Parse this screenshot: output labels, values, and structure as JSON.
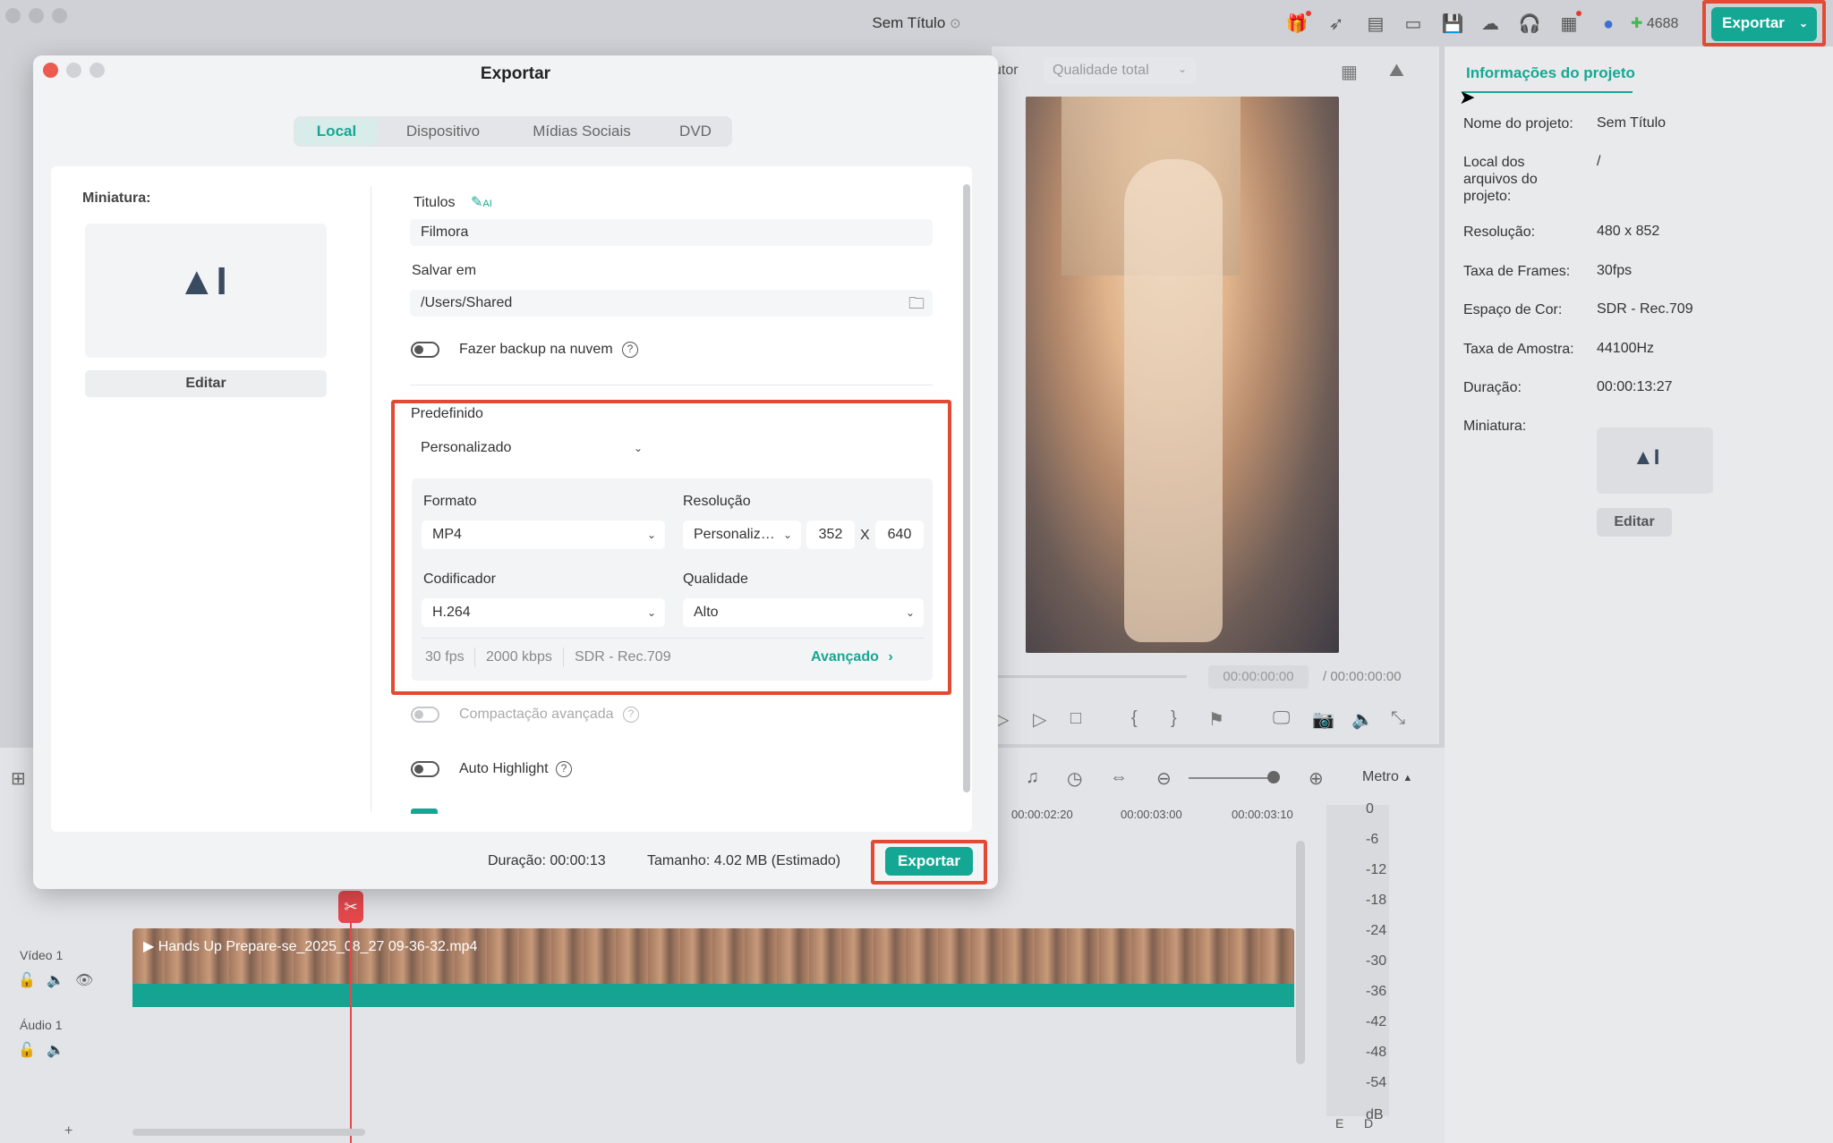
{
  "app": {
    "title": "Sem Título",
    "credits": "4688",
    "export_label": "Exportar"
  },
  "project_info": {
    "tab_label": "Informações do projeto",
    "rows": [
      {
        "label": "Nome do projeto:",
        "value": "Sem Título"
      },
      {
        "label": "Local dos arquivos do projeto:",
        "value": "/"
      },
      {
        "label": "Resolução:",
        "value": "480 x 852"
      },
      {
        "label": "Taxa de Frames:",
        "value": "30fps"
      },
      {
        "label": "Espaço de Cor:",
        "value": "SDR - Rec.709"
      },
      {
        "label": "Taxa de Amostra:",
        "value": "44100Hz"
      },
      {
        "label": "Duração:",
        "value": "00:00:13:27"
      },
      {
        "label": "Miniatura:",
        "value": ""
      }
    ],
    "edit_label": "Editar"
  },
  "preview": {
    "partial_label": "utor",
    "quality_select": "Qualidade total",
    "current_time": "00:00:00:00",
    "total_time": "/ 00:00:00:00"
  },
  "timeline": {
    "ruler": [
      "00:00:02:20",
      "00:00:03:00",
      "00:00:03:10"
    ],
    "metro_label": "Metro",
    "video_track": "Vídeo 1",
    "audio_track": "Áudio 1",
    "clip_name": "Hands Up Prepare-se_2025_08_27 09-36-32.mp4",
    "meter_scale": [
      "0",
      "-6",
      "-12",
      "-18",
      "-24",
      "-30",
      "-36",
      "-42",
      "-48",
      "-54",
      "dB"
    ],
    "meter_channels": [
      "E",
      "D"
    ]
  },
  "dialog": {
    "title": "Exportar",
    "tabs": [
      "Local",
      "Dispositivo",
      "Mídias Sociais",
      "DVD"
    ],
    "active_tab": "Local",
    "thumbnail_label": "Miniatura:",
    "thumbnail_edit": "Editar",
    "titles_label": "Titulos",
    "ai_badge": "AI",
    "title_value": "Filmora",
    "save_in_label": "Salvar em",
    "save_path": "/Users/Shared",
    "cloud_backup_label": "Fazer backup na nuvem",
    "preset_label": "Predefinido",
    "preset_value": "Personalizado",
    "format_label": "Formato",
    "format_value": "MP4",
    "resolution_label": "Resolução",
    "resolution_preset": "Personaliz…",
    "res_width": "352",
    "res_x": "X",
    "res_height": "640",
    "encoder_label": "Codificador",
    "encoder_value": "H.264",
    "quality_label": "Qualidade",
    "quality_value": "Alto",
    "meta_fps": "30 fps",
    "meta_bitrate": "2000 kbps",
    "meta_color": "SDR - Rec.709",
    "advanced_label": "Avançado",
    "compact_label": "Compactação avançada",
    "highlight_label": "Auto Highlight",
    "duration_text": "Duração: 00:00:13",
    "size_text": "Tamanho: 4.02 MB (Estimado)",
    "export_label": "Exportar"
  }
}
